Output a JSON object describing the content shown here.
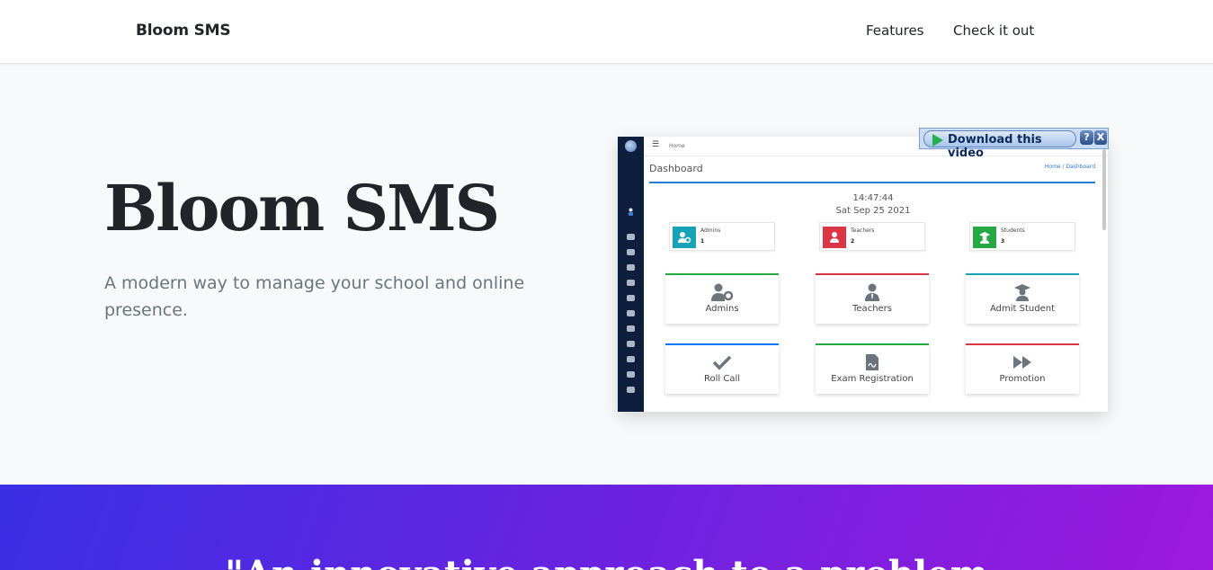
{
  "navbar": {
    "brand": "Bloom SMS",
    "links": [
      "Features",
      "Check it out"
    ]
  },
  "hero": {
    "title": "Bloom SMS",
    "subtitle": "A modern way to manage your school and online presence."
  },
  "preview": {
    "topbar_home": "Home",
    "heading": "Dashboard",
    "breadcrumb": "Home / Dashboard",
    "time": "14:47:44",
    "date": "Sat Sep 25 2021",
    "stats": [
      {
        "label": "Admins",
        "value": "1",
        "color": "#17a2b8",
        "icon": "user-gear-icon"
      },
      {
        "label": "Teachers",
        "value": "2",
        "color": "#dc3545",
        "icon": "user-tie-icon"
      },
      {
        "label": "Students",
        "value": "3",
        "color": "#28a745",
        "icon": "graduate-icon"
      }
    ],
    "cards": [
      {
        "label": "Admins",
        "border": "#28a745",
        "icon": "user-gear-icon"
      },
      {
        "label": "Teachers",
        "border": "#dc3545",
        "icon": "user-tie-icon"
      },
      {
        "label": "Admit Student",
        "border": "#17a2b8",
        "icon": "graduate-icon"
      },
      {
        "label": "Roll Call",
        "border": "#007bff",
        "icon": "check-icon"
      },
      {
        "label": "Exam Registration",
        "border": "#28a745",
        "icon": "file-signature-icon"
      },
      {
        "label": "Promotion",
        "border": "#dc3545",
        "icon": "forward-icon"
      }
    ]
  },
  "download_overlay": {
    "label": "Download this video",
    "help": "?",
    "close": "X"
  },
  "band": {
    "quote": "\"An innovative approach to a problem"
  },
  "colors": {
    "accent": "#2a7ad6",
    "sidebar": "#0d1f3c",
    "band_start": "#3a2fe6",
    "band_end": "#9d19de"
  }
}
